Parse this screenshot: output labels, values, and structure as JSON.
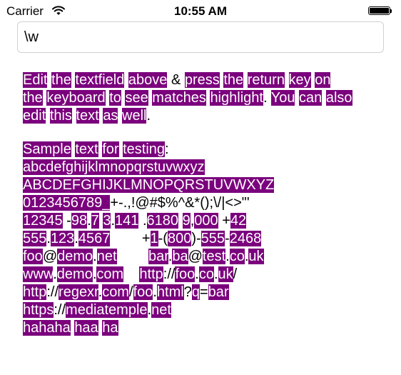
{
  "status_bar": {
    "carrier": "Carrier",
    "time": "10:55 AM",
    "icons": [
      "wifi-icon",
      "battery-icon"
    ]
  },
  "search_field": {
    "value": "\\w"
  },
  "highlight_color": "#7b007d",
  "paragraphs": [
    {
      "lines": [
        [
          {
            "t": "Edit",
            "m": true
          },
          {
            "t": " "
          },
          {
            "t": "the",
            "m": true
          },
          {
            "t": " "
          },
          {
            "t": "textfield",
            "m": true
          },
          {
            "t": " "
          },
          {
            "t": "above",
            "m": true
          },
          {
            "t": " & "
          },
          {
            "t": "press",
            "m": true
          },
          {
            "t": " "
          },
          {
            "t": "the",
            "m": true
          },
          {
            "t": " "
          },
          {
            "t": "return",
            "m": true
          },
          {
            "t": " "
          },
          {
            "t": "key",
            "m": true
          },
          {
            "t": " "
          },
          {
            "t": "on",
            "m": true
          }
        ],
        [
          {
            "t": "the",
            "m": true
          },
          {
            "t": " "
          },
          {
            "t": "keyboard",
            "m": true
          },
          {
            "t": " "
          },
          {
            "t": "to",
            "m": true
          },
          {
            "t": " "
          },
          {
            "t": "see",
            "m": true
          },
          {
            "t": " "
          },
          {
            "t": "matches",
            "m": true
          },
          {
            "t": " "
          },
          {
            "t": "highlight",
            "m": true
          },
          {
            "t": ". "
          },
          {
            "t": "You",
            "m": true
          },
          {
            "t": " "
          },
          {
            "t": "can",
            "m": true
          },
          {
            "t": " "
          },
          {
            "t": "also",
            "m": true
          }
        ],
        [
          {
            "t": "edit",
            "m": true
          },
          {
            "t": " "
          },
          {
            "t": "this",
            "m": true
          },
          {
            "t": " "
          },
          {
            "t": "text",
            "m": true
          },
          {
            "t": " "
          },
          {
            "t": "as",
            "m": true
          },
          {
            "t": " "
          },
          {
            "t": "well",
            "m": true
          },
          {
            "t": "."
          }
        ]
      ]
    },
    {
      "lines": [
        [
          {
            "t": "Sample",
            "m": true
          },
          {
            "t": " "
          },
          {
            "t": "text",
            "m": true
          },
          {
            "t": " "
          },
          {
            "t": "for",
            "m": true
          },
          {
            "t": " "
          },
          {
            "t": "testing",
            "m": true
          },
          {
            "t": ":"
          }
        ],
        [
          {
            "t": "abcdefghijklmnopqrstuvwxyz",
            "m": true
          }
        ],
        [
          {
            "t": "ABCDEFGHIJKLMNOPQRSTUVWXYZ",
            "m": true
          }
        ],
        [
          {
            "t": "0123456789_",
            "m": true
          },
          {
            "t": "+-.,!@#$%^&*();\\/|<>\"'"
          }
        ],
        [
          {
            "t": "12345",
            "m": true
          },
          {
            "t": " -"
          },
          {
            "t": "98",
            "m": true
          },
          {
            "t": "."
          },
          {
            "t": "7",
            "m": true
          },
          {
            "t": " "
          },
          {
            "t": "3",
            "m": true
          },
          {
            "t": "."
          },
          {
            "t": "141",
            "m": true
          },
          {
            "t": " ."
          },
          {
            "t": "6180",
            "m": true
          },
          {
            "t": " "
          },
          {
            "t": "9",
            "m": true
          },
          {
            "t": ","
          },
          {
            "t": "000",
            "m": true
          },
          {
            "t": " +"
          },
          {
            "t": "42",
            "m": true
          }
        ],
        [
          {
            "t": "555",
            "m": true
          },
          {
            "t": "."
          },
          {
            "t": "123",
            "m": true
          },
          {
            "t": "."
          },
          {
            "t": "4567",
            "m": true
          },
          {
            "t": "        +"
          },
          {
            "t": "1",
            "m": true
          },
          {
            "t": "-("
          },
          {
            "t": "800",
            "m": true
          },
          {
            "t": ")-"
          },
          {
            "t": "555",
            "m": true
          },
          {
            "t": "-"
          },
          {
            "t": "2468",
            "m": true
          }
        ],
        [
          {
            "t": "foo",
            "m": true
          },
          {
            "t": "@"
          },
          {
            "t": "demo",
            "m": true
          },
          {
            "t": "."
          },
          {
            "t": "net",
            "m": true
          },
          {
            "t": "        "
          },
          {
            "t": "bar",
            "m": true
          },
          {
            "t": "."
          },
          {
            "t": "ba",
            "m": true
          },
          {
            "t": "@"
          },
          {
            "t": "test",
            "m": true
          },
          {
            "t": "."
          },
          {
            "t": "co",
            "m": true
          },
          {
            "t": "."
          },
          {
            "t": "uk",
            "m": true
          }
        ],
        [
          {
            "t": "www",
            "m": true
          },
          {
            "t": "."
          },
          {
            "t": "demo",
            "m": true
          },
          {
            "t": "."
          },
          {
            "t": "com",
            "m": true
          },
          {
            "t": "    "
          },
          {
            "t": "http",
            "m": true
          },
          {
            "t": "://"
          },
          {
            "t": "foo",
            "m": true
          },
          {
            "t": "."
          },
          {
            "t": "co",
            "m": true
          },
          {
            "t": "."
          },
          {
            "t": "uk",
            "m": true
          },
          {
            "t": "/"
          }
        ],
        [
          {
            "t": "http",
            "m": true
          },
          {
            "t": "://"
          },
          {
            "t": "regexr",
            "m": true
          },
          {
            "t": "."
          },
          {
            "t": "com",
            "m": true
          },
          {
            "t": "/"
          },
          {
            "t": "foo",
            "m": true
          },
          {
            "t": "."
          },
          {
            "t": "html",
            "m": true
          },
          {
            "t": "?"
          },
          {
            "t": "q",
            "m": true
          },
          {
            "t": "="
          },
          {
            "t": "bar",
            "m": true
          }
        ],
        [
          {
            "t": "https",
            "m": true
          },
          {
            "t": "://"
          },
          {
            "t": "mediatemple",
            "m": true
          },
          {
            "t": "."
          },
          {
            "t": "net",
            "m": true
          }
        ],
        [
          {
            "t": "hahaha",
            "m": true
          },
          {
            "t": " "
          },
          {
            "t": "haa",
            "m": true
          },
          {
            "t": " "
          },
          {
            "t": "ha",
            "m": true
          }
        ]
      ]
    }
  ]
}
